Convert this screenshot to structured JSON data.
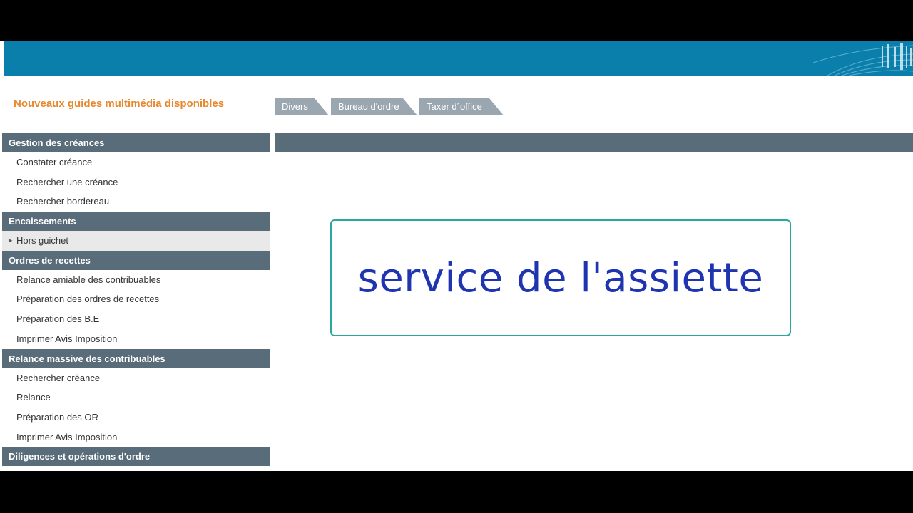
{
  "header": {
    "guides_link": "Nouveaux guides multimédia disponibles"
  },
  "tabs": [
    {
      "label": "Divers"
    },
    {
      "label": "Bureau d'ordre"
    },
    {
      "label": "Taxer d´office"
    }
  ],
  "sidebar": {
    "sections": [
      {
        "title": "Gestion des créances",
        "items": [
          "Constater créance",
          "Rechercher une créance",
          "Rechercher bordereau"
        ]
      },
      {
        "title": "Encaissements",
        "items": [
          "Hors guichet"
        ]
      },
      {
        "title": "Ordres de recettes",
        "items": [
          "Relance amiable des contribuables",
          "Préparation des ordres de recettes",
          "Préparation des B.E",
          "Imprimer Avis Imposition"
        ]
      },
      {
        "title": "Relance massive des contribuables",
        "items": [
          "Rechercher créance",
          "Relance",
          "Préparation des OR",
          "Imprimer Avis Imposition"
        ]
      },
      {
        "title": "Diligences et opérations d'ordre",
        "items": []
      }
    ],
    "active_item": "Hors guichet",
    "active_marker_icon": "triangle-right-icon"
  },
  "overlay": {
    "title": "service de l'assiette"
  },
  "colors": {
    "banner": "#0b7fab",
    "section_header": "#596c79",
    "tab": "#9aa7b1",
    "guides_link": "#e8892f",
    "overlay_text": "#1f34b0",
    "overlay_border": "#2aa8a0"
  }
}
